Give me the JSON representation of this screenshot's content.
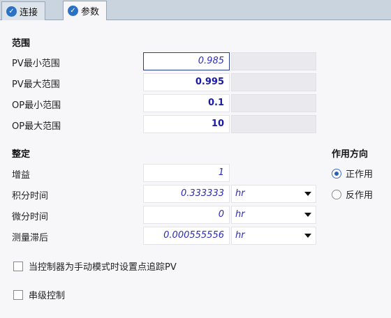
{
  "tabs": [
    {
      "label": "连接",
      "icon": "check-circle-icon"
    },
    {
      "label": "参数",
      "icon": "check-circle-icon"
    }
  ],
  "range_section": {
    "title": "范围",
    "rows": [
      {
        "label": "PV最小范围",
        "value": "0.985"
      },
      {
        "label": "PV最大范围",
        "value": "0.995"
      },
      {
        "label": "OP最小范围",
        "value": "0.1"
      },
      {
        "label": "OP最大范围",
        "value": "10"
      }
    ]
  },
  "tuning_section": {
    "title": "整定",
    "rows": [
      {
        "label": "增益",
        "value": "1"
      },
      {
        "label": "积分时间",
        "value": "0.333333",
        "unit": "hr"
      },
      {
        "label": "微分时间",
        "value": "0",
        "unit": "hr"
      },
      {
        "label": "测量滞后",
        "value": "0.000555556",
        "unit": "hr"
      }
    ]
  },
  "direction": {
    "title": "作用方向",
    "options": [
      {
        "label": "正作用",
        "checked": true
      },
      {
        "label": "反作用",
        "checked": false
      }
    ]
  },
  "options": {
    "track_pv_label": "当控制器为手动模式时设置点追踪PV",
    "cascade_label": "串级控制"
  },
  "colors": {
    "value_text": "#2c2cb8",
    "accent": "#2b72c6"
  }
}
